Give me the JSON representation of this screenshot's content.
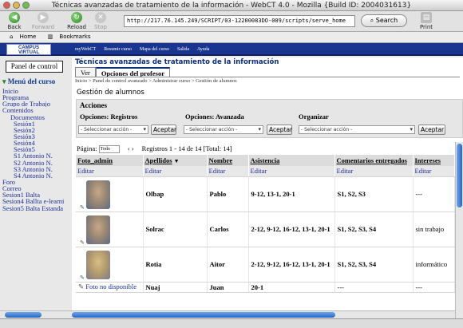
{
  "window": {
    "title": "Técnicas avanzadas de tratamiento de la información - WebCT 4.0 - Mozilla {Build ID: 2004031613}"
  },
  "toolbar": {
    "back": "Back",
    "forward": "Forward",
    "reload": "Reload",
    "stop": "Stop",
    "url": "http://217.76.145.249/SCRIPT/03-12200083DO-009/scripts/serve_home",
    "search": "Search",
    "print": "Print"
  },
  "bookmarks": {
    "home": "Home",
    "bookmarks": "Bookmarks"
  },
  "banner": {
    "logo_line1": "CAMPUS",
    "logo_line2": "VIRTUAL",
    "nav": [
      "myWebCT",
      "Resumir curso",
      "Mapa del curso",
      "Salida",
      "Ayuda"
    ]
  },
  "left": {
    "panel_button": "Panel de control",
    "menu_title": "Menú del curso",
    "items": [
      "Inicio",
      "Programa",
      "Grupo de Trabajo",
      "Contenidos",
      "Documentos",
      "Sesión1",
      "Sesión2",
      "Sesión3",
      "Sesión4",
      "Sesión5",
      "S1 Antonio N.",
      "S2 Antonio N.",
      "S3 Antonio N.",
      "S4 Antonio N.",
      "Foro",
      "Correo",
      "Sesion1 Balta",
      "Sesion4 Ballta e-learni",
      "Sesion5 Balta Estanda"
    ]
  },
  "course": {
    "title": "Técnicas avanzadas de tratamiento de la información",
    "tab_view": "Ver",
    "tab_teacher": "Opciones del profesor",
    "breadcrumb": "Inicio > Panel de control avanzado > Administrar curso > Gestión de alumnos",
    "section": "Gestión de alumnos"
  },
  "acciones": {
    "title": "Acciones",
    "groups": [
      "Opciones: Registros",
      "Opciones: Avanzada",
      "Organizar"
    ],
    "select_placeholder": "- Seleccionar acción -",
    "accept": "Aceptar"
  },
  "pager": {
    "label": "Página:",
    "select": "Todo",
    "nav": "‹  ›",
    "records": "Registros 1 - 14 de 14 [Total: 14]"
  },
  "table": {
    "headers": [
      "Foto_admin",
      "Apellidos",
      "Nombre",
      "Asistencia",
      "Comentarios entregados",
      "Intereses"
    ],
    "sort_indicator": "▼",
    "edit_label": "Editar",
    "rows": [
      {
        "apellidos": "Olbap",
        "nombre": "Pablo",
        "asistencia": "9-12, 13-1, 20-1",
        "comentarios": "S1, S2, S3",
        "intereses": "---"
      },
      {
        "apellidos": "Solrac",
        "nombre": "Carlos",
        "asistencia": "2-12, 9-12, 16-12, 13-1, 20-1",
        "comentarios": "S1, S2, S3, S4",
        "intereses": "sin trabajo"
      },
      {
        "apellidos": "Rotia",
        "nombre": "Aitor",
        "asistencia": "2-12, 9-12, 16-12, 13-1, 20-1",
        "comentarios": "S1, S2, S3, S4",
        "intereses": "informático"
      },
      {
        "foto": "Foto no disponible",
        "apellidos": "Nuaj",
        "nombre": "Juan",
        "asistencia": "20-1",
        "comentarios": "---",
        "intereses": "---"
      }
    ]
  },
  "colors": {
    "banner": "#1a3590",
    "link": "#1d2f9a",
    "title": "#0d2d7c"
  },
  "icons": [
    "back-icon",
    "forward-icon",
    "reload-icon",
    "stop-icon",
    "search-icon",
    "print-icon",
    "home-icon",
    "bookmarks-icon",
    "photo-edit-icon"
  ]
}
